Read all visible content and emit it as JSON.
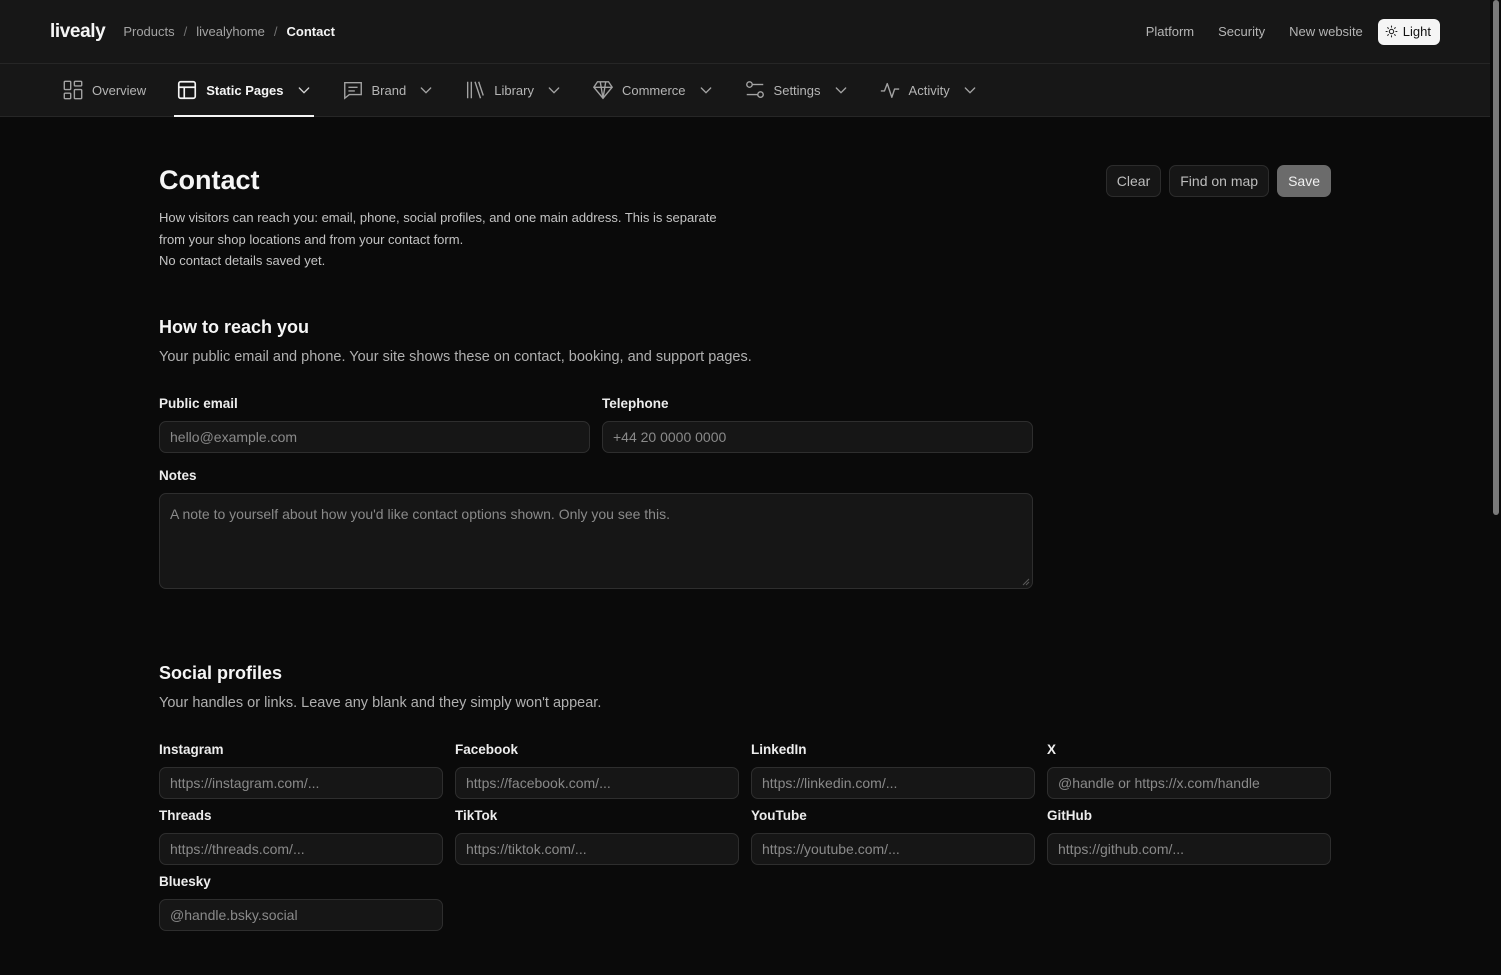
{
  "app": {
    "logo": "livealy"
  },
  "breadcrumb": [
    {
      "label": "Products"
    },
    {
      "label": "livealyhome"
    },
    {
      "label": "Contact"
    }
  ],
  "breadcrumb_separator": "/",
  "topnav": {
    "platform": "Platform",
    "security": "Security",
    "new_website": "New website",
    "theme_toggle": "Light"
  },
  "tabs": [
    {
      "label": "Overview",
      "icon": "grid-icon"
    },
    {
      "label": "Static Pages",
      "icon": "layout-icon",
      "active": true
    },
    {
      "label": "Brand",
      "icon": "message-lines-icon"
    },
    {
      "label": "Library",
      "icon": "books-icon"
    },
    {
      "label": "Commerce",
      "icon": "diamond-icon"
    },
    {
      "label": "Settings",
      "icon": "sliders-icon"
    },
    {
      "label": "Activity",
      "icon": "pulse-icon"
    }
  ],
  "page": {
    "title": "Contact",
    "description_line1": "How visitors can reach you: email, phone, social profiles, and one main address. This is separate from your shop locations and from your contact form.",
    "status": "No contact details saved yet.",
    "actions": {
      "clear": "Clear",
      "find_on_map": "Find on map",
      "save": "Save"
    }
  },
  "reach": {
    "title": "How to reach you",
    "description": "Your public email and phone. Your site shows these on contact, booking, and support pages.",
    "email": {
      "label": "Public email",
      "placeholder": "hello@example.com"
    },
    "telephone": {
      "label": "Telephone",
      "placeholder": "+44 20 0000 0000"
    },
    "notes": {
      "label": "Notes",
      "placeholder": "A note to yourself about how you'd like contact options shown. Only you see this."
    }
  },
  "social": {
    "title": "Social profiles",
    "description": "Your handles or links. Leave any blank and they simply won't appear.",
    "fields": [
      {
        "label": "Instagram",
        "placeholder": "https://instagram.com/..."
      },
      {
        "label": "Facebook",
        "placeholder": "https://facebook.com/..."
      },
      {
        "label": "LinkedIn",
        "placeholder": "https://linkedin.com/..."
      },
      {
        "label": "X",
        "placeholder": "@handle or https://x.com/handle"
      },
      {
        "label": "Threads",
        "placeholder": "https://threads.com/..."
      },
      {
        "label": "TikTok",
        "placeholder": "https://tiktok.com/..."
      },
      {
        "label": "YouTube",
        "placeholder": "https://youtube.com/..."
      },
      {
        "label": "GitHub",
        "placeholder": "https://github.com/..."
      },
      {
        "label": "Bluesky",
        "placeholder": "@handle.bsky.social"
      }
    ]
  },
  "colors": {
    "background": "#0a0a0a",
    "surface": "#171717",
    "accent": "#f5f5f5",
    "save_button": "#6b6b6b"
  }
}
